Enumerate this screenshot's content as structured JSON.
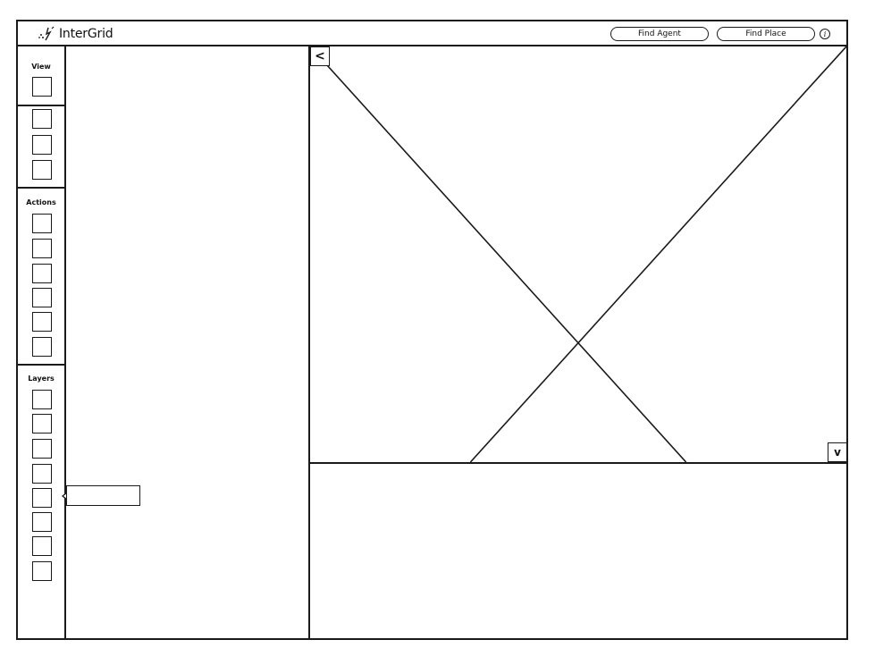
{
  "app": {
    "title": "InterGrid"
  },
  "header": {
    "find_agent_label": "Find Agent",
    "find_place_label": "Find Place",
    "info_glyph": "i",
    "info_icon": "info-icon",
    "logo_icon": "sparkle-logo-icon"
  },
  "toolbar": {
    "sections": [
      {
        "label": "View"
      },
      {
        "label": ""
      },
      {
        "label": "Actions"
      },
      {
        "label": "Layers"
      }
    ]
  },
  "map": {
    "collapse_left_glyph": "<",
    "collapse_down_glyph": "v",
    "placeholder": "image-placeholder"
  },
  "colors": {
    "stroke": "#1a1a1a",
    "background": "#ffffff"
  }
}
